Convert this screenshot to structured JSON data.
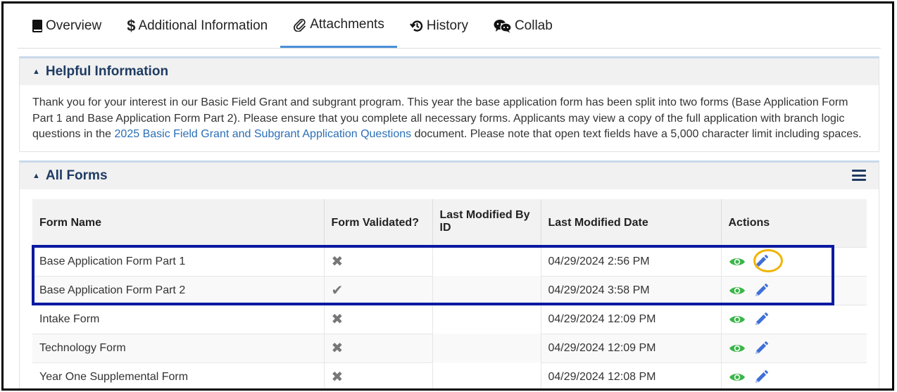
{
  "tabs": [
    {
      "label": "Overview",
      "icon": "book-icon"
    },
    {
      "label": "Additional Information",
      "icon": "dollar-icon"
    },
    {
      "label": "Attachments",
      "icon": "paperclip-icon",
      "active": true
    },
    {
      "label": "History",
      "icon": "history-icon"
    },
    {
      "label": "Collab",
      "icon": "chat-icon"
    }
  ],
  "helpful": {
    "title": "Helpful Information",
    "text_before": "Thank you for your interest in our Basic Field Grant and subgrant program. This year the base application form has been split into two forms (Base Application Form Part 1 and Base Application Form Part 2). Please ensure that you complete all necessary forms. Applicants may view a copy of the full application with branch logic questions in the ",
    "link": "2025 Basic Field Grant and Subgrant Application Questions",
    "text_after": " document. Please note that open text fields have a 5,000 character limit including spaces."
  },
  "forms": {
    "title": "All Forms",
    "columns": [
      "Form Name",
      "Form Validated?",
      "Last Modified By ID",
      "Last Modified Date",
      "Actions"
    ],
    "rows": [
      {
        "name": "Base Application Form Part 1",
        "validated": false,
        "modified_by": "",
        "date": "04/29/2024 2:56 PM"
      },
      {
        "name": "Base Application Form Part 2",
        "validated": true,
        "modified_by": "",
        "date": "04/29/2024 3:58 PM"
      },
      {
        "name": "Intake Form",
        "validated": false,
        "modified_by": "",
        "date": "04/29/2024 12:09 PM"
      },
      {
        "name": "Technology Form",
        "validated": false,
        "modified_by": "",
        "date": "04/29/2024 12:09 PM"
      },
      {
        "name": "Year One Supplemental Form",
        "validated": false,
        "modified_by": "",
        "date": "04/29/2024 12:08 PM"
      }
    ]
  },
  "colors": {
    "accent": "#4a90d9",
    "heading": "#1f3b63",
    "link": "#2a6fb6",
    "eye": "#3bb54a",
    "pencil": "#3f6fd8",
    "highlight_box": "#0a1aa0",
    "highlight_circle": "#f1b400"
  }
}
